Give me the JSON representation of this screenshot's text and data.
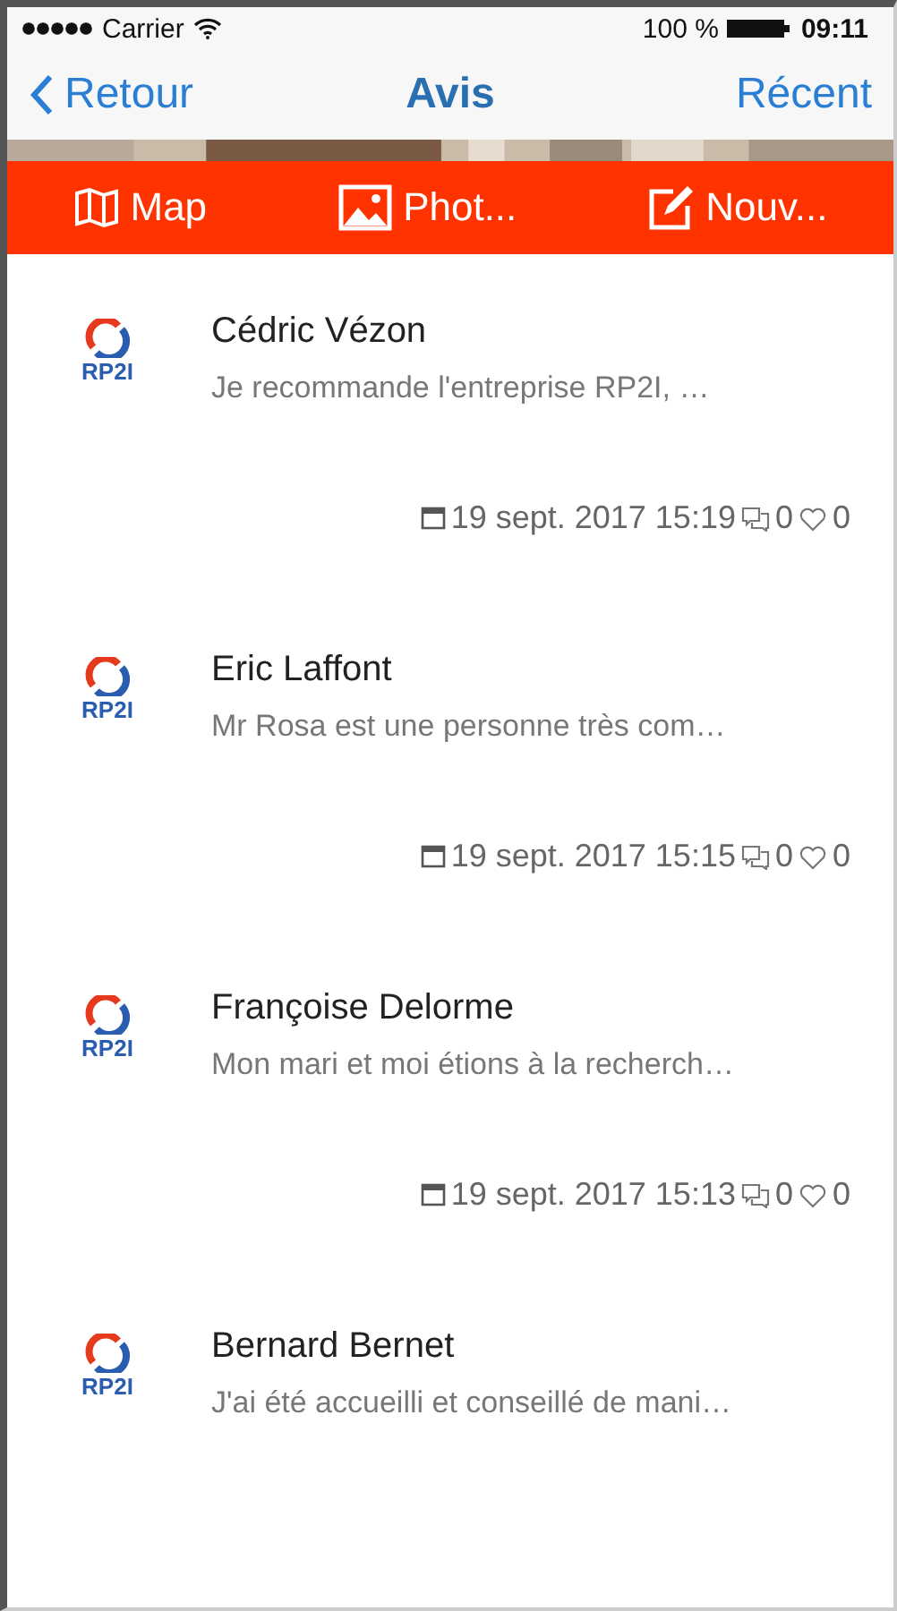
{
  "status_bar": {
    "carrier": "Carrier",
    "battery": "100 %",
    "time": "09:11"
  },
  "nav": {
    "back": "Retour",
    "title": "Avis",
    "right": "Récent"
  },
  "actions": [
    {
      "kind": "map",
      "label": "Map"
    },
    {
      "label": "Phot..."
    },
    {
      "kind": "new",
      "label": "Nouv..."
    }
  ],
  "reviews": [
    {
      "logo": "RP2I",
      "author": "Cédric Vézon",
      "excerpt": "Je recommande l'entreprise RP2I, …",
      "date": "19 sept. 2017 15:19",
      "comments": "0",
      "likes": "0"
    },
    {
      "logo": "RP2I",
      "author": "Eric Laffont",
      "excerpt": "Mr Rosa est une personne très com…",
      "date": "19 sept. 2017 15:15",
      "comments": "0",
      "likes": "0"
    },
    {
      "logo": "RP2I",
      "author": "Françoise Delorme",
      "excerpt": "Mon mari et moi étions à la recherch…",
      "date": "19 sept. 2017 15:13",
      "comments": "0",
      "likes": "0"
    },
    {
      "logo": "RP2I",
      "author": "Bernard Bernet",
      "excerpt": "J'ai été accueilli et conseillé de mani…"
    }
  ]
}
